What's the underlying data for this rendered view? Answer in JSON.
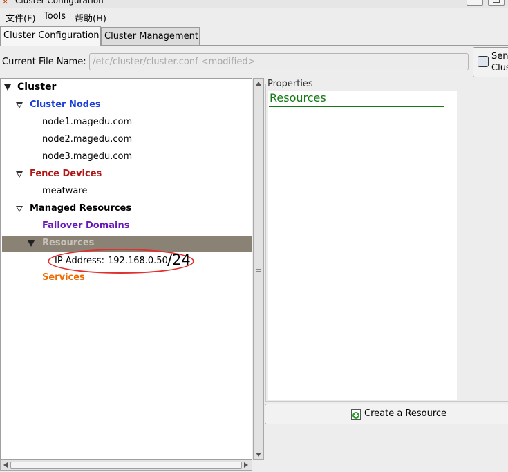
{
  "window": {
    "title": "Cluster Configuration"
  },
  "menubar": {
    "file": "文件(F)",
    "tools": "Tools",
    "help": "帮助(H)"
  },
  "tabs": [
    {
      "label": "Cluster Configuration",
      "selected": true
    },
    {
      "label": "Cluster Management",
      "selected": false
    }
  ],
  "file_row": {
    "label": "Current File Name:",
    "value": "/etc/cluster/cluster.conf <modified>",
    "send_button_line1": "Sen",
    "send_button_line2": "Clus"
  },
  "tree": {
    "root": "Cluster",
    "cluster_nodes": {
      "label": "Cluster Nodes",
      "color": "#1b3fd8",
      "items": [
        "node1.magedu.com",
        "node2.magedu.com",
        "node3.magedu.com"
      ]
    },
    "fence_devices": {
      "label": "Fence Devices",
      "color": "#b01818",
      "items": [
        "meatware"
      ]
    },
    "managed_resources": {
      "label": "Managed Resources",
      "failover_domains": {
        "label": "Failover Domains",
        "color": "#6a16b8"
      },
      "resources": {
        "label": "Resources",
        "selected": true,
        "items": [
          {
            "label": "IP Address:",
            "value": "192.168.0.50"
          }
        ]
      },
      "services": {
        "label": "Services",
        "color": "#f06a00"
      }
    }
  },
  "annotation": {
    "text": "/24",
    "suffix": "24",
    "color": "#e03030"
  },
  "properties": {
    "legend": "Properties",
    "heading": "Resources",
    "heading_color": "#117a11",
    "create_button": "Create a Resource"
  }
}
